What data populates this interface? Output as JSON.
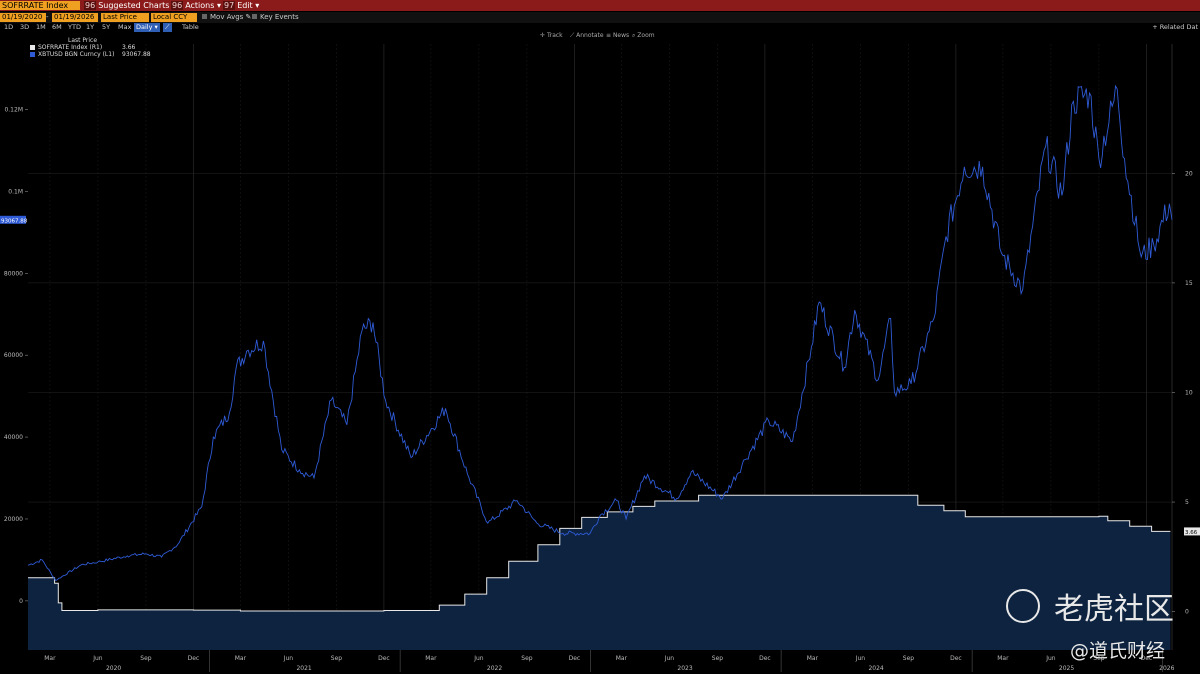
{
  "header": {
    "ticker": "SOFRRATE Index",
    "buttons": [
      {
        "num": "96",
        "label": "Suggested Charts"
      },
      {
        "num": "96",
        "label": "Actions"
      },
      {
        "num": "97",
        "label": "Edit"
      }
    ]
  },
  "controls": {
    "start_date": "01/19/2020",
    "end_date": "01/19/2026",
    "field": "Last Price",
    "currency": "Local CCY",
    "mov_avgs": "Mov Avgs",
    "key_events": "Key Events"
  },
  "ranges": [
    "1D",
    "3D",
    "1M",
    "6M",
    "YTD",
    "1Y",
    "5Y",
    "Max"
  ],
  "frequency": "Daily",
  "table_label": "Table",
  "related_label": "Related Dat",
  "tools": [
    "Track",
    "Annotate",
    "News",
    "Zoom"
  ],
  "watermark": {
    "brand": "老虎社区",
    "author": "@道氏财经"
  },
  "colors": {
    "sofr": "#e8e8e8",
    "btc": "#2f5bd6",
    "area": "#0d2340",
    "background": "#000000"
  },
  "chart_data": {
    "type": "line",
    "legend_title": "Last Price",
    "x_tick_labels": [
      "Mar",
      "Jun",
      "Sep",
      "Dec",
      "Mar",
      "Jun",
      "Sep",
      "Dec",
      "Mar",
      "Jun",
      "Sep",
      "Dec",
      "Mar",
      "Jun",
      "Sep",
      "Dec",
      "Mar",
      "Jun",
      "Sep",
      "Dec",
      "Mar",
      "Jun",
      "Sep",
      "Dec"
    ],
    "year_labels": [
      "2020",
      "2021",
      "2022",
      "2023",
      "2024",
      "2025",
      "2026"
    ],
    "left_axis": {
      "ticks": [
        "0",
        "20000",
        "40000",
        "60000",
        "80000",
        "0.1M",
        "0.12M"
      ],
      "ylim": [
        -12000,
        136000
      ],
      "last_label": "93067.88"
    },
    "right_axis": {
      "ticks": [
        "0",
        "5",
        "10",
        "15",
        "20"
      ],
      "ylim": [
        -1.75,
        25.9
      ],
      "last_label": "3.66"
    },
    "series": [
      {
        "name": "SOFRRATE Index (R1)",
        "value_label": "3.66",
        "axis": "right",
        "points": [
          [
            "2020-01-19",
            1.55
          ],
          [
            "2020-03-01",
            1.55
          ],
          [
            "2020-03-10",
            1.3
          ],
          [
            "2020-03-17",
            0.4
          ],
          [
            "2020-03-24",
            0.05
          ],
          [
            "2020-06-01",
            0.08
          ],
          [
            "2020-12-01",
            0.07
          ],
          [
            "2021-03-01",
            0.03
          ],
          [
            "2021-12-01",
            0.05
          ],
          [
            "2022-03-17",
            0.3
          ],
          [
            "2022-05-05",
            0.8
          ],
          [
            "2022-06-16",
            1.55
          ],
          [
            "2022-07-28",
            2.3
          ],
          [
            "2022-09-22",
            3.05
          ],
          [
            "2022-11-03",
            3.8
          ],
          [
            "2022-12-15",
            4.3
          ],
          [
            "2023-02-02",
            4.55
          ],
          [
            "2023-03-23",
            4.8
          ],
          [
            "2023-05-04",
            5.05
          ],
          [
            "2023-07-27",
            5.31
          ],
          [
            "2024-09-01",
            5.31
          ],
          [
            "2024-09-19",
            4.85
          ],
          [
            "2024-11-08",
            4.6
          ],
          [
            "2024-12-19",
            4.33
          ],
          [
            "2025-09-01",
            4.35
          ],
          [
            "2025-09-18",
            4.15
          ],
          [
            "2025-10-30",
            3.9
          ],
          [
            "2025-12-11",
            3.66
          ],
          [
            "2026-01-16",
            3.66
          ]
        ]
      },
      {
        "name": "XBTUSD BGN Curncy (L1)",
        "value_label": "93067.88",
        "axis": "left",
        "points": [
          [
            "2020-01-19",
            8700
          ],
          [
            "2020-02-15",
            10000
          ],
          [
            "2020-03-12",
            5000
          ],
          [
            "2020-04-30",
            8800
          ],
          [
            "2020-06-01",
            9500
          ],
          [
            "2020-07-27",
            11000
          ],
          [
            "2020-09-01",
            11500
          ],
          [
            "2020-10-01",
            10700
          ],
          [
            "2020-11-01",
            13800
          ],
          [
            "2020-12-17",
            23000
          ],
          [
            "2021-01-08",
            40000
          ],
          [
            "2021-02-08",
            46000
          ],
          [
            "2021-02-21",
            57000
          ],
          [
            "2021-03-13",
            61000
          ],
          [
            "2021-04-14",
            63500
          ],
          [
            "2021-05-19",
            37000
          ],
          [
            "2021-06-22",
            32000
          ],
          [
            "2021-07-20",
            30000
          ],
          [
            "2021-08-22",
            49000
          ],
          [
            "2021-09-21",
            43000
          ],
          [
            "2021-10-20",
            66000
          ],
          [
            "2021-11-10",
            68000
          ],
          [
            "2021-12-04",
            49000
          ],
          [
            "2022-01-22",
            35000
          ],
          [
            "2022-03-29",
            47000
          ],
          [
            "2022-05-10",
            31000
          ],
          [
            "2022-06-18",
            19000
          ],
          [
            "2022-08-13",
            24500
          ],
          [
            "2022-09-20",
            19000
          ],
          [
            "2022-11-09",
            16500
          ],
          [
            "2022-12-31",
            16500
          ],
          [
            "2023-01-20",
            21000
          ],
          [
            "2023-02-20",
            24500
          ],
          [
            "2023-03-10",
            20000
          ],
          [
            "2023-04-14",
            30500
          ],
          [
            "2023-06-15",
            25000
          ],
          [
            "2023-07-13",
            31500
          ],
          [
            "2023-09-11",
            25000
          ],
          [
            "2023-10-24",
            34500
          ],
          [
            "2023-12-08",
            44000
          ],
          [
            "2024-01-23",
            39000
          ],
          [
            "2024-02-28",
            62000
          ],
          [
            "2024-03-14",
            73000
          ],
          [
            "2024-05-01",
            57000
          ],
          [
            "2024-05-21",
            71000
          ],
          [
            "2024-07-05",
            54000
          ],
          [
            "2024-07-29",
            69000
          ],
          [
            "2024-08-05",
            51000
          ],
          [
            "2024-09-06",
            53000
          ],
          [
            "2024-10-20",
            69000
          ],
          [
            "2024-11-12",
            89000
          ],
          [
            "2024-12-17",
            106000
          ],
          [
            "2025-01-21",
            106000
          ],
          [
            "2025-02-26",
            85000
          ],
          [
            "2025-04-08",
            76000
          ],
          [
            "2025-05-22",
            111000
          ],
          [
            "2025-06-22",
            99000
          ],
          [
            "2025-07-14",
            122000
          ],
          [
            "2025-08-14",
            124000
          ],
          [
            "2025-09-01",
            108000
          ],
          [
            "2025-10-06",
            125000
          ],
          [
            "2025-10-20",
            108000
          ],
          [
            "2025-11-21",
            84000
          ],
          [
            "2025-12-15",
            87000
          ],
          [
            "2026-01-14",
            97000
          ],
          [
            "2026-01-19",
            93068
          ]
        ]
      }
    ]
  }
}
